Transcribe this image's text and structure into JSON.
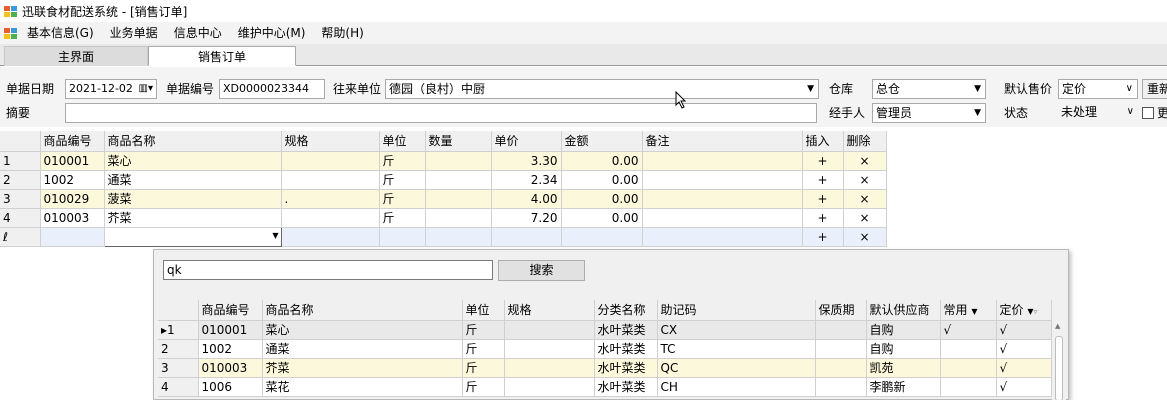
{
  "window": {
    "title": "迅联食材配送系统 - [销售订单]"
  },
  "menu": [
    "基本信息(G)",
    "业务单据",
    "信息中心",
    "维护中心(M)",
    "帮助(H)"
  ],
  "tabs": {
    "home": "主界面",
    "current": "销售订单"
  },
  "form": {
    "date_label": "单据日期",
    "date_value": "2021-12-02",
    "no_label": "单据编号",
    "no_value": "XD0000023344",
    "partner_label": "往来单位",
    "partner_value": "德园（良村）中厨",
    "warehouse_label": "仓库",
    "warehouse_value": "总仓",
    "price_label": "默认售价",
    "price_value": "定价",
    "refresh_label": "重新",
    "memo_label": "摘要",
    "memo_value": "",
    "handler_label": "经手人",
    "handler_value": "管理员",
    "status_label": "状态",
    "status_value": "未处理",
    "more_label": "更"
  },
  "order_grid": {
    "headers": [
      "商品编号",
      "商品名称",
      "规格",
      "单位",
      "数量",
      "单价",
      "金额",
      "备注",
      "插入",
      "删除"
    ],
    "rows": [
      {
        "idx": "1",
        "code": "010001",
        "name": "菜心",
        "spec": "",
        "unit": "斤",
        "qty": "",
        "price": "3.30",
        "amount": "0.00",
        "memo": "",
        "ins": "+",
        "del": "×"
      },
      {
        "idx": "2",
        "code": "1002",
        "name": "通菜",
        "spec": "",
        "unit": "斤",
        "qty": "",
        "price": "2.34",
        "amount": "0.00",
        "memo": "",
        "ins": "+",
        "del": "×"
      },
      {
        "idx": "3",
        "code": "010029",
        "name": "菠菜",
        "spec": ".",
        "unit": "斤",
        "qty": "",
        "price": "4.00",
        "amount": "0.00",
        "memo": "",
        "ins": "+",
        "del": "×"
      },
      {
        "idx": "4",
        "code": "010003",
        "name": "芥菜",
        "spec": "",
        "unit": "斤",
        "qty": "",
        "price": "7.20",
        "amount": "0.00",
        "memo": "",
        "ins": "+",
        "del": "×"
      }
    ],
    "new_row": {
      "idx": "ℓ",
      "ins": "+",
      "del": "×"
    }
  },
  "popup": {
    "search_value": "qk",
    "search_button": "搜索",
    "headers": [
      "商品编号",
      "商品名称",
      "单位",
      "规格",
      "分类名称",
      "助记码",
      "保质期",
      "默认供应商",
      "常用",
      "定价"
    ],
    "rows": [
      {
        "idx": "▸1",
        "code": "010001",
        "name": "菜心",
        "unit": "斤",
        "spec": "",
        "category": "水叶菜类",
        "mnemonic": "CX",
        "shelf": "",
        "supplier": "自购",
        "common": "√",
        "price": "√"
      },
      {
        "idx": "2",
        "code": "1002",
        "name": "通菜",
        "unit": "斤",
        "spec": "",
        "category": "水叶菜类",
        "mnemonic": "TC",
        "shelf": "",
        "supplier": "自购",
        "common": "",
        "price": "√"
      },
      {
        "idx": "3",
        "code": "010003",
        "name": "芥菜",
        "unit": "斤",
        "spec": "",
        "category": "水叶菜类",
        "mnemonic": "QC",
        "shelf": "",
        "supplier": "凯苑",
        "common": "",
        "price": "√"
      },
      {
        "idx": "4",
        "code": "1006",
        "name": "菜花",
        "unit": "斤",
        "spec": "",
        "category": "水叶菜类",
        "mnemonic": "CH",
        "shelf": "",
        "supplier": "李鹏新",
        "common": "",
        "price": "√"
      }
    ]
  }
}
